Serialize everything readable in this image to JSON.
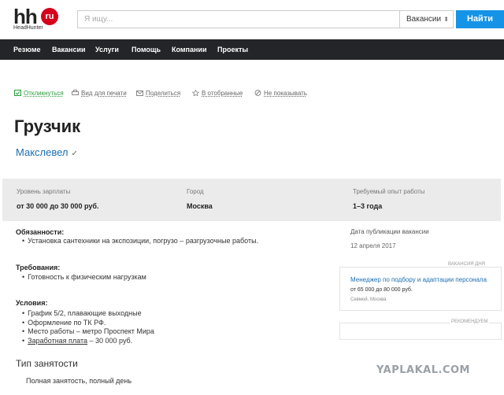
{
  "header": {
    "logo_main": "hh",
    "logo_badge": "ru",
    "logo_sub": "HeadHunter",
    "search_placeholder": "Я ищу...",
    "search_type": "Вакансии",
    "search_button": "Найти"
  },
  "nav": {
    "items": [
      "Резюме",
      "Вакансии",
      "Услуги",
      "Помощь",
      "Компании",
      "Проекты"
    ]
  },
  "actions": {
    "respond": "Откликнуться",
    "print": "Вид для печати",
    "share": "Поделиться",
    "favorite": "В отобранные",
    "hide": "Не показывать"
  },
  "vacancy": {
    "title": "Грузчик",
    "company": "Макслевел",
    "company_mark": "✓"
  },
  "info": {
    "salary_label": "Уровень зарплаты",
    "salary_value": "от 30 000 до 30 000 руб.",
    "city_label": "Город",
    "city_value": "Москва",
    "experience_label": "Требуемый опыт работы",
    "experience_value": "1–3 года"
  },
  "description": {
    "duties_heading": "Обязанности:",
    "duties": [
      "Установка сантехники на экспозиции, погрузо – разгрузочные работы."
    ],
    "requirements_heading": "Требования:",
    "requirements": [
      "Готовность к физическим нагрузкам"
    ],
    "conditions_heading": "Условия:",
    "conditions": [
      "График 5/2, плавающие выходные",
      "Оформление по ТК РФ.",
      "Место работы – метро Проспект Мира"
    ],
    "salary_link": "Заработная плата",
    "salary_tail": " – 30 000 руб."
  },
  "employment": {
    "heading": "Тип занятости",
    "value": "Полная занятость, полный день"
  },
  "sidebar": {
    "pub_label": "Дата публикации вакансии",
    "pub_date": "12 апреля 2017",
    "card_tag": "ВАКАНСИЯ ДНЯ",
    "card_title": "Менеджер по подбору и адаптации персонала",
    "card_salary": "от 65 000 до 80 000 руб.",
    "card_location": "Севмой, Москва",
    "rec_tag": "РЕКОМЕНДУЕМ"
  },
  "watermark": "YAPLAKAL.COM",
  "colors": {
    "nav_bg": "#232529",
    "button": "#1593e6",
    "link": "#1a6fb3",
    "respond": "#2a9c3c",
    "logo_red": "#d6001c"
  }
}
